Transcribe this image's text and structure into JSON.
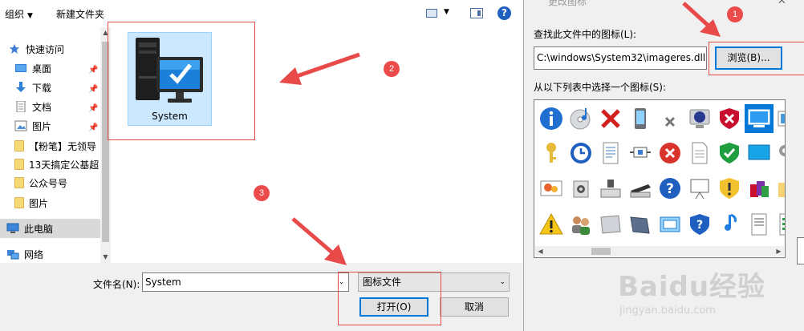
{
  "open_dialog": {
    "toolbar": {
      "organize": "组织",
      "new_folder": "新建文件夹"
    },
    "nav": [
      {
        "label": "快速访问",
        "icon": "star-icon",
        "pinned": false
      },
      {
        "label": "桌面",
        "icon": "desktop-icon",
        "pinned": true
      },
      {
        "label": "下载",
        "icon": "download-arrow-icon",
        "pinned": true
      },
      {
        "label": "文档",
        "icon": "document-icon",
        "pinned": true
      },
      {
        "label": "图片",
        "icon": "pictures-icon",
        "pinned": true
      },
      {
        "label": "【粉笔】无领导",
        "icon": "folder-icon",
        "pinned": false
      },
      {
        "label": "13天搞定公基超",
        "icon": "folder-icon",
        "pinned": false
      },
      {
        "label": "公众号号",
        "icon": "folder-icon",
        "pinned": false
      },
      {
        "label": "图片",
        "icon": "folder-icon",
        "pinned": false
      },
      {
        "label": "此电脑",
        "icon": "this-pc-icon",
        "pinned": false,
        "selected": true
      },
      {
        "label": "网络",
        "icon": "network-icon",
        "pinned": false
      }
    ],
    "file": {
      "name": "System",
      "icon": "computer-system-icon"
    },
    "filename_label": "文件名(N):",
    "filename_value": "System",
    "filetype_value": "图标文件",
    "open_button": "打开(O)",
    "cancel_button": "取消"
  },
  "change_icon_dialog": {
    "title": "更改图标",
    "lookup_label": "查找此文件中的图标(L):",
    "path_value": "C:\\windows\\System32\\imageres.dll",
    "browse_button": "浏览(B)...",
    "select_label": "从以下列表中选择一个图标(S):",
    "icons": [
      [
        "info-icon",
        "cd-audio-icon",
        "red-x-icon",
        "mobile-device-icon",
        "small-x-icon",
        "monitor-icon",
        "shield-x-icon",
        "computer-selected-icon",
        "picture-frame-icon"
      ],
      [
        "key-icon",
        "clock-restore-icon",
        "document-lines-icon",
        "projector-icon",
        "error-circle-icon",
        "blank-page-icon",
        "shield-check-icon",
        "blue-screen-icon",
        "gear-doc-icon"
      ],
      [
        "photo-album-icon",
        "media-drive-icon",
        "disk-drive-icon",
        "scanner-icon",
        "help-circle-icon",
        "presentation-icon",
        "shield-warning-icon",
        "programs-icon",
        "folder-icon"
      ],
      [
        "warning-icon",
        "users-icon",
        "gray-panel-icon",
        "dark-folder-icon",
        "screen-window-icon",
        "shield-help-icon",
        "music-note-icon",
        "text-doc-icon",
        "list-doc-icon"
      ]
    ]
  },
  "annotations": {
    "badges": [
      "1",
      "2",
      "3"
    ]
  },
  "watermark": {
    "text": "Baidu经验",
    "url": "jingyan.baidu.com"
  }
}
